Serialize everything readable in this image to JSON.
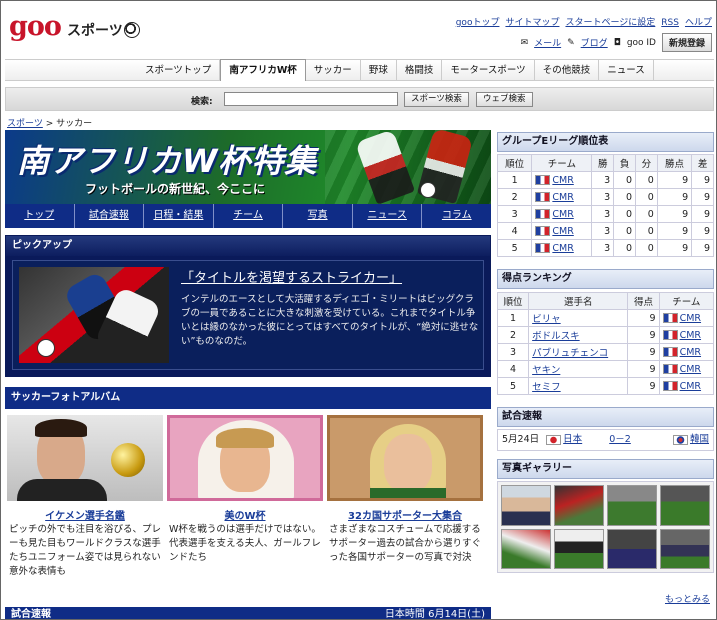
{
  "header": {
    "logo": "goo",
    "brand": "スポーツ",
    "toplinks": [
      "gooトップ",
      "サイトマップ",
      "スタートページに設定",
      "RSS",
      "ヘルプ"
    ],
    "sublinks": [
      "メール",
      "ブログ",
      "goo ID"
    ],
    "signup": "新規登録"
  },
  "nav": {
    "items": [
      "スポーツトップ",
      "南アフリカW杯",
      "サッカー",
      "野球",
      "格闘技",
      "モータースポーツ",
      "その他競技",
      "ニュース"
    ],
    "active": 1
  },
  "search": {
    "label": "検索:",
    "btn_sports": "スポーツ検索",
    "btn_web": "ウェブ検索"
  },
  "breadcrumb": {
    "home": "スポーツ",
    "sep": ">",
    "current": "サッカー"
  },
  "banner": {
    "title": "南アフリカW杯特集",
    "subtitle": "フットボールの新世紀、今ここに"
  },
  "subnav": [
    "トップ",
    "試合速報",
    "日程・結果",
    "チーム",
    "写真",
    "ニュース",
    "コラム"
  ],
  "pickup": {
    "heading": "ピックアップ",
    "title": "「タイトルを渇望するストライカー」",
    "desc": "インテルのエースとして大活躍するディエゴ・ミリートはビッグクラブの一員であることに大きな刺激を受けている。これまでタイトル争いとは縁のなかった彼にとってはすべてのタイトルが、“絶対に逃せない”ものなのだ。"
  },
  "album": {
    "heading": "サッカーフォトアルバム",
    "cards": [
      {
        "title": "イケメン選手名鑑",
        "desc": "ピッチの外でも注目を浴びる、プレーも見た目もワールドクラスな選手たちユニフォーム姿では見られない意外な表情も"
      },
      {
        "title": "美のW杯",
        "desc": "W杯を戦うのは選手だけではない。代表選手を支える夫人、ガールフレンドたち"
      },
      {
        "title": "32カ国サポーター大集合",
        "desc": "さまざまなコスチュームで応援するサポーター過去の試合から選りすぐった各国サポーターの写真で対決"
      }
    ]
  },
  "bottom_bar": {
    "title": "試合速報",
    "right": "日本時間 6月14日(土)"
  },
  "standings": {
    "heading": "グループEリーグ順位表",
    "columns": [
      "順位",
      "チーム",
      "勝",
      "負",
      "分",
      "勝点",
      "差"
    ],
    "rows": [
      [
        "1",
        "CMR",
        "3",
        "0",
        "0",
        "9",
        "9"
      ],
      [
        "2",
        "CMR",
        "3",
        "0",
        "0",
        "9",
        "9"
      ],
      [
        "3",
        "CMR",
        "3",
        "0",
        "0",
        "9",
        "9"
      ],
      [
        "4",
        "CMR",
        "3",
        "0",
        "0",
        "9",
        "9"
      ],
      [
        "5",
        "CMR",
        "3",
        "0",
        "0",
        "9",
        "9"
      ]
    ]
  },
  "scorers": {
    "heading": "得点ランキング",
    "columns": [
      "順位",
      "選手名",
      "得点",
      "チーム"
    ],
    "rows": [
      [
        "1",
        "ビリャ",
        "9",
        "CMR"
      ],
      [
        "2",
        "ボドルスキ",
        "9",
        "CMR"
      ],
      [
        "3",
        "パブリュチェンコ",
        "9",
        "CMR"
      ],
      [
        "4",
        "ヤキン",
        "9",
        "CMR"
      ],
      [
        "5",
        "セミフ",
        "9",
        "CMR"
      ]
    ]
  },
  "match": {
    "heading": "試合速報",
    "date": "5月24日",
    "home": "日本",
    "score": "0－2",
    "away": "韓国"
  },
  "gallery": {
    "heading": "写真ギャラリー",
    "more": "もっとみる"
  },
  "colors": {
    "navy": "#0f2c86",
    "logo_red": "#c8142a",
    "link": "#1a3d99"
  }
}
